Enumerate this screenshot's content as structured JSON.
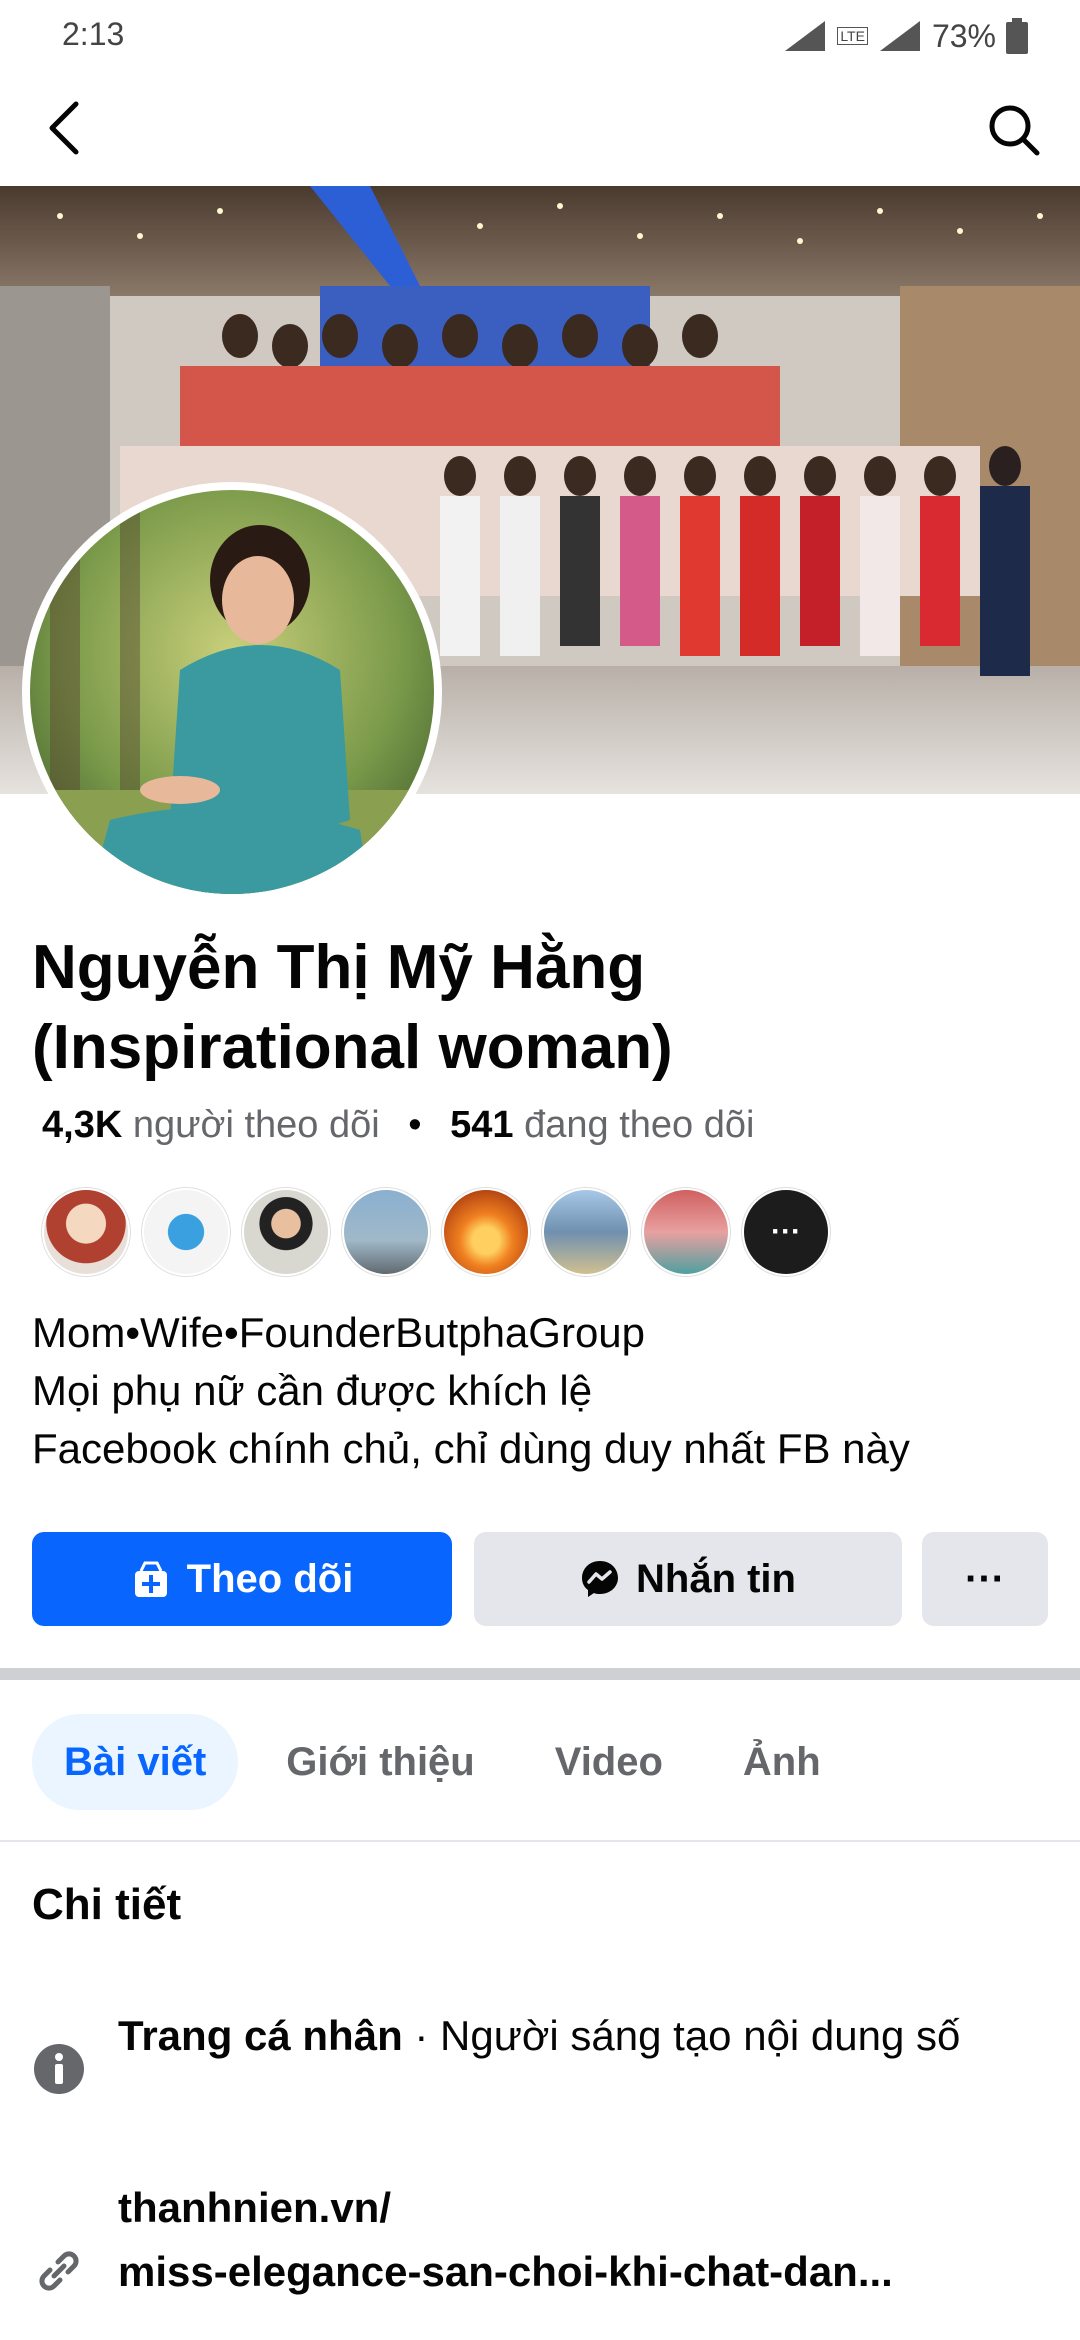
{
  "status_bar": {
    "time": "2:13",
    "battery": "73%",
    "network": "LTE"
  },
  "profile": {
    "name_line1": "Nguyễn Thị Mỹ Hằng",
    "name_line2": "(Inspirational woman)",
    "followers_count": "4,3K",
    "followers_label": "người theo dõi",
    "separator": "•",
    "following_count": "541",
    "following_label": "đang theo dõi",
    "more_friends_label": "···",
    "bio": [
      "Mom•Wife•FounderButphaGroup",
      "Mọi phụ nữ cần được khích lệ",
      "Facebook chính chủ, chỉ dùng duy nhất FB này"
    ]
  },
  "actions": {
    "follow_label": "Theo dõi",
    "message_label": "Nhắn tin",
    "more_label": "···"
  },
  "tabs": [
    {
      "label": "Bài viết",
      "active": true
    },
    {
      "label": "Giới thiệu",
      "active": false
    },
    {
      "label": "Video",
      "active": false
    },
    {
      "label": "Ảnh",
      "active": false
    }
  ],
  "details": {
    "title": "Chi tiết",
    "page_type_bold": "Trang cá nhân",
    "page_type_rest": " · Người sáng tạo nội dung số",
    "link_line1": "thanhnien.vn/",
    "link_line2": "miss-elegance-san-choi-khi-chat-dan..."
  },
  "colors": {
    "primary": "#0866ff",
    "tab_active_bg": "#ebf5ff",
    "secondary_btn": "#e4e6eb",
    "muted_text": "#65676b"
  }
}
